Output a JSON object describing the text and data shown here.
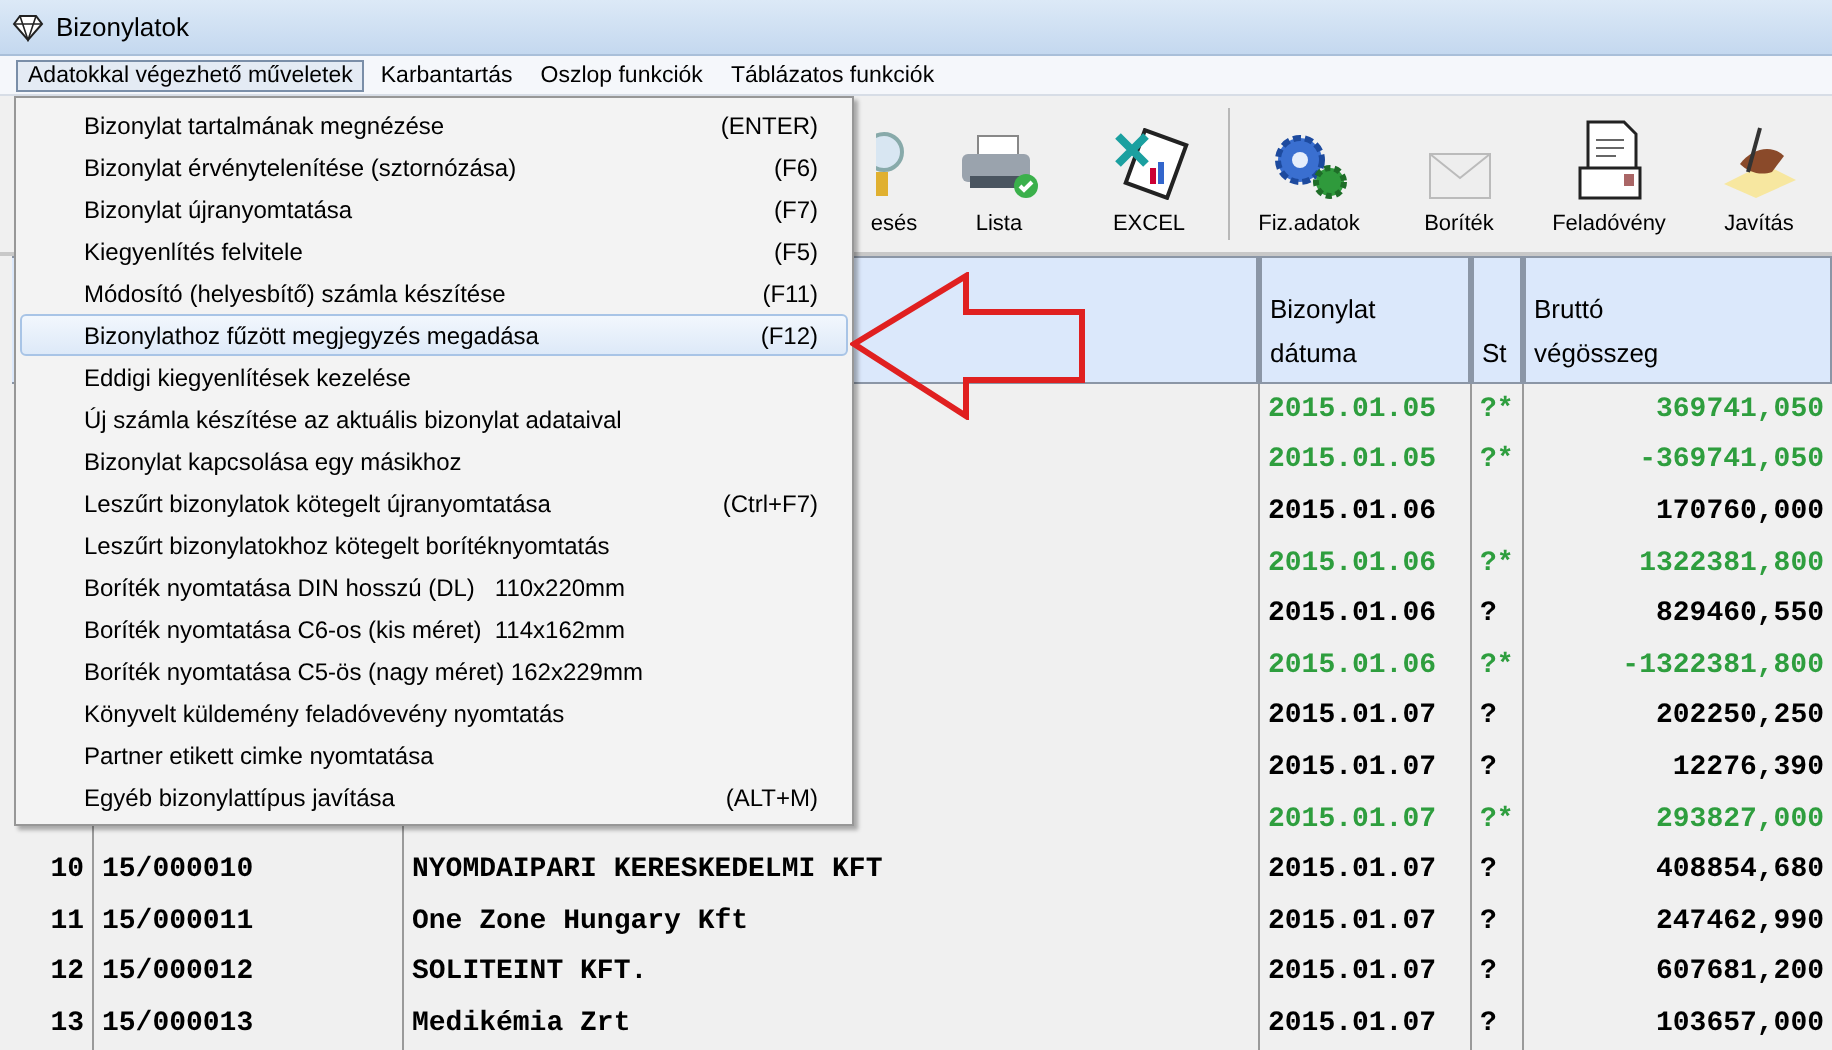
{
  "window": {
    "title": "Bizonylatok"
  },
  "menu_bar": [
    {
      "label": "Adatokkal végezhető műveletek",
      "selected": true
    },
    {
      "label": "Karbantartás",
      "selected": false
    },
    {
      "label": "Oszlop funkciók",
      "selected": false
    },
    {
      "label": "Táblázatos funkciók",
      "selected": false
    }
  ],
  "dropdown": {
    "items": [
      {
        "label": "Bizonylat tartalmának megnézése",
        "shortcut": "(ENTER)",
        "selected": false
      },
      {
        "label": "Bizonylat érvénytelenítése (sztornózása)",
        "shortcut": "(F6)",
        "selected": false
      },
      {
        "label": "Bizonylat újranyomtatása",
        "shortcut": "(F7)",
        "selected": false
      },
      {
        "label": "Kiegyenlítés felvitele",
        "shortcut": "(F5)",
        "selected": false
      },
      {
        "label": "Módosító (helyesbítő) számla készítése",
        "shortcut": "(F11)",
        "selected": false
      },
      {
        "label": "Bizonylathoz fűzött megjegyzés megadása",
        "shortcut": "(F12)",
        "selected": true
      },
      {
        "label": "Eddigi kiegyenlítések kezelése",
        "selected": false
      },
      {
        "label": "Új számla készítése az aktuális bizonylat adataival",
        "selected": false
      },
      {
        "label": "Bizonylat kapcsolása egy másikhoz",
        "selected": false
      },
      {
        "label": "Leszűrt bizonylatok kötegelt újranyomtatása",
        "shortcut": "(Ctrl+F7)",
        "selected": false
      },
      {
        "label": "Leszűrt bizonylatokhoz kötegelt borítéknyomtatás",
        "selected": false
      },
      {
        "label": "Boríték nyomtatása DIN hosszú (DL)   110x220mm",
        "selected": false
      },
      {
        "label": "Boríték nyomtatása C6-os (kis méret)  114x162mm",
        "selected": false
      },
      {
        "label": "Boríték nyomtatása C5-ös (nagy méret) 162x229mm",
        "selected": false
      },
      {
        "label": "Könyvelt küldemény feladóvevény nyomtatás",
        "selected": false
      },
      {
        "label": "Partner etikett cimke nyomtatása",
        "selected": false
      },
      {
        "label": "Egyéb bizonylattípus javítása",
        "shortcut": "(ALT+M)",
        "selected": false
      }
    ]
  },
  "toolbar": [
    {
      "label": "esés",
      "kind": "search"
    },
    {
      "label": "Lista",
      "kind": "printer"
    },
    {
      "label": "EXCEL",
      "kind": "excel"
    },
    {
      "label": "Fiz.adatok",
      "kind": "gears"
    },
    {
      "label": "Boríték",
      "kind": "envelope"
    },
    {
      "label": "Feladóvény",
      "kind": "document"
    },
    {
      "label": "Javítás",
      "kind": "pen"
    }
  ],
  "table": {
    "columns": [
      {
        "label": "Bizonylat dátuma"
      },
      {
        "label": "St"
      },
      {
        "label": "Bruttó végösszeg"
      }
    ],
    "rows": [
      {
        "date": "2015.01.05",
        "status": "?*",
        "amount": "369741,050",
        "color": "#2e9e3e"
      },
      {
        "date": "2015.01.05",
        "status": "?*",
        "amount": "-369741,050",
        "color": "#2e9e3e"
      },
      {
        "date": "2015.01.06",
        "amount": "170760,000",
        "color": "#000000"
      },
      {
        "date": "2015.01.06",
        "status": "?*",
        "amount": "1322381,800",
        "color": "#2e9e3e"
      },
      {
        "date": "2015.01.06",
        "status": "?",
        "amount": "829460,550",
        "color": "#000000"
      },
      {
        "date": "2015.01.06",
        "status": "?*",
        "amount": "-1322381,800",
        "color": "#2e9e3e"
      },
      {
        "date": "2015.01.07",
        "status": "?",
        "amount": "202250,250",
        "color": "#000000"
      },
      {
        "date": "2015.01.07",
        "status": "?",
        "amount": "12276,390",
        "color": "#000000"
      },
      {
        "date": "2015.01.07",
        "status": "?*",
        "amount": "293827,000",
        "color": "#2e9e3e"
      },
      {
        "number": "10",
        "id": "15/000010",
        "partner": "NYOMDAIPARI KERESKEDELMI KFT",
        "date": "2015.01.07",
        "status": "?",
        "amount": "408854,680",
        "color": "#000000"
      },
      {
        "number": "11",
        "id": "15/000011",
        "partner": "One Zone Hungary Kft",
        "date": "2015.01.07",
        "status": "?",
        "amount": "247462,990",
        "color": "#000000"
      },
      {
        "number": "12",
        "id": "15/000012",
        "partner": "SOLITEINT KFT.",
        "date": "2015.01.07",
        "status": "?",
        "amount": "607681,200",
        "color": "#000000"
      },
      {
        "number": "13",
        "id": "15/000013",
        "partner": "Medikémia Zrt",
        "date": "2015.01.07",
        "status": "?",
        "amount": "103657,000",
        "color": "#000000"
      }
    ]
  }
}
